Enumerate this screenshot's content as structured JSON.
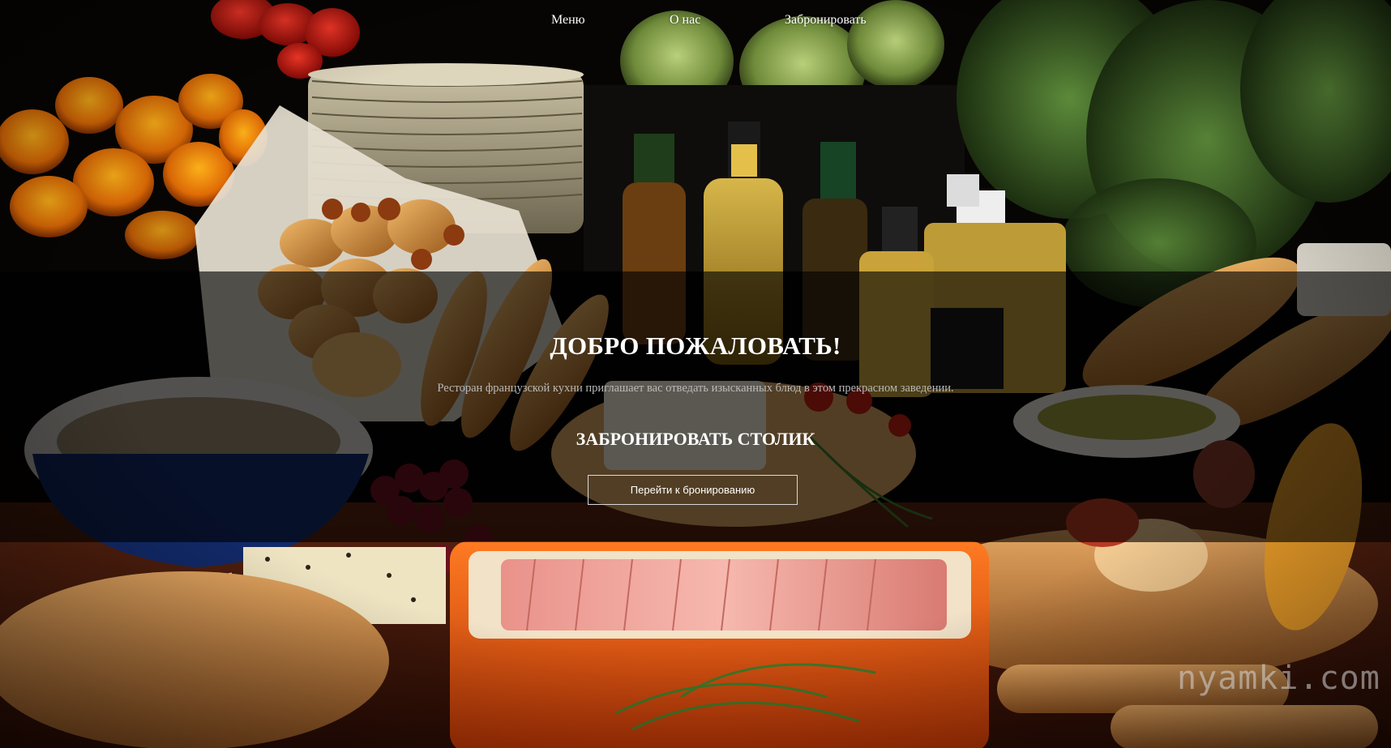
{
  "nav": {
    "items": [
      {
        "label": "Меню"
      },
      {
        "label": "О нас"
      },
      {
        "label": "Забронировать"
      }
    ]
  },
  "hero": {
    "title": "ДОБРО ПОЖАЛОВАТЬ!",
    "subtitle": "Ресторан французской кухни приглашает вас отведать изысканных блюд в этом прекрасном заведении.",
    "reserve_title": "ЗАБРОНИРОВАТЬ СТОЛИК",
    "reserve_button_label": "Перейти к бронированию",
    "background_image": "french-cuisine-buffet-photo"
  },
  "watermark": {
    "text": "nyamki.com"
  },
  "colors": {
    "overlay": "#000000",
    "text_primary": "#ffffff",
    "text_secondary": "#b9b9b9",
    "button_border": "#d8d8d8"
  }
}
